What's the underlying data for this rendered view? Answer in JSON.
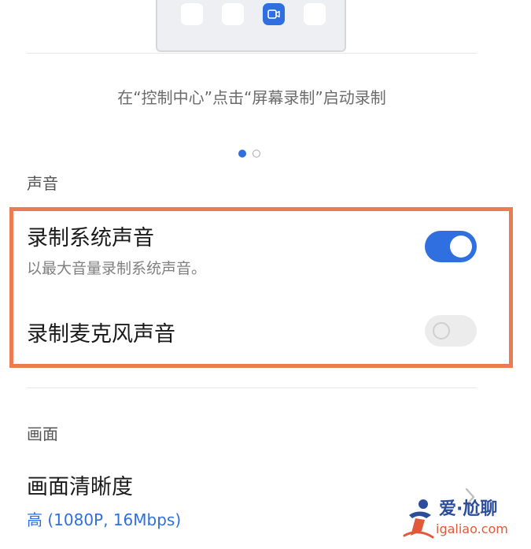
{
  "carousel": {
    "instruction": "在“控制中心”点击“屏幕录制”启动录制",
    "page_count": 2,
    "active_page": 1
  },
  "sound_section": {
    "label": "声音",
    "record_system_audio": {
      "title": "录制系统声音",
      "subtitle": "以最大音量录制系统声音。",
      "enabled": true
    },
    "record_mic_audio": {
      "title": "录制麦克风声音",
      "enabled": false
    }
  },
  "picture_section": {
    "label": "画面",
    "resolution": {
      "title": "画面清晰度",
      "value": "高 (1080P, 16Mbps)"
    }
  },
  "watermark": {
    "title": "爱·尬聊",
    "url": "igaliao.com"
  },
  "colors": {
    "accent": "#2f6fe0",
    "highlight_border": "#ec7b52"
  },
  "icons": [
    "video-camera-icon",
    "chevron-right-icon",
    "watermark-logo"
  ]
}
